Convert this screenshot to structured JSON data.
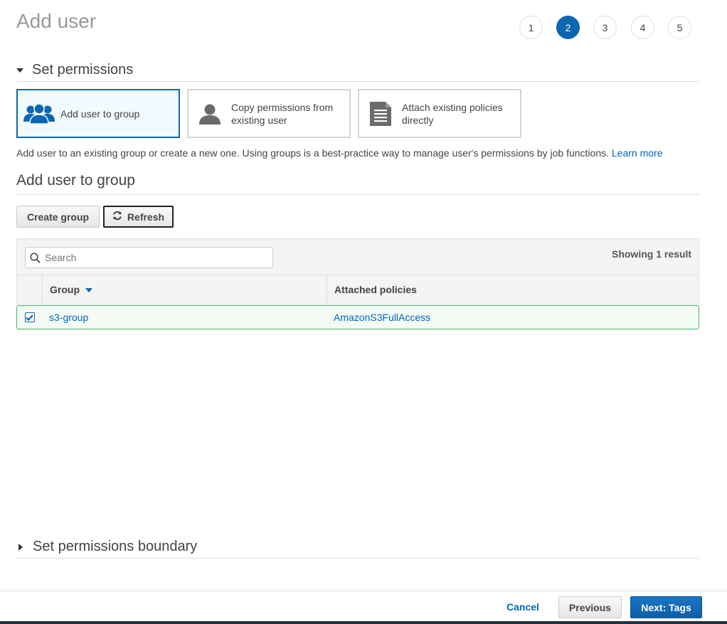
{
  "header": {
    "title": "Add user"
  },
  "steps": [
    "1",
    "2",
    "3",
    "4",
    "5"
  ],
  "active_step": "2",
  "permissions": {
    "section_title": "Set permissions",
    "options": [
      {
        "label_line1": "Add user to group",
        "label_line2": "",
        "icon": "users-group-icon",
        "selected": true
      },
      {
        "label_line1": "Copy permissions from",
        "label_line2": "existing user",
        "icon": "user-icon",
        "selected": false
      },
      {
        "label_line1": "Attach existing policies",
        "label_line2": "directly",
        "icon": "document-icon",
        "selected": false
      }
    ],
    "description": "Add user to an existing group or create a new one. Using groups is a best-practice way to manage user's permissions by job functions.",
    "learn_more": "Learn more"
  },
  "group_section": {
    "title": "Add user to group",
    "create_group_label": "Create group",
    "refresh_label": "Refresh",
    "search_placeholder": "Search",
    "result_count": "Showing 1 result",
    "columns": {
      "group": "Group",
      "policies": "Attached policies"
    },
    "rows": [
      {
        "group": "s3-group",
        "policies": "AmazonS3FullAccess",
        "checked": true
      }
    ]
  },
  "boundary": {
    "title": "Set permissions boundary"
  },
  "footer": {
    "cancel": "Cancel",
    "previous": "Previous",
    "next": "Next: Tags"
  },
  "colors": {
    "primary": "#0d66b2",
    "link": "#0066bb",
    "selected_row_border": "#44b36b"
  }
}
